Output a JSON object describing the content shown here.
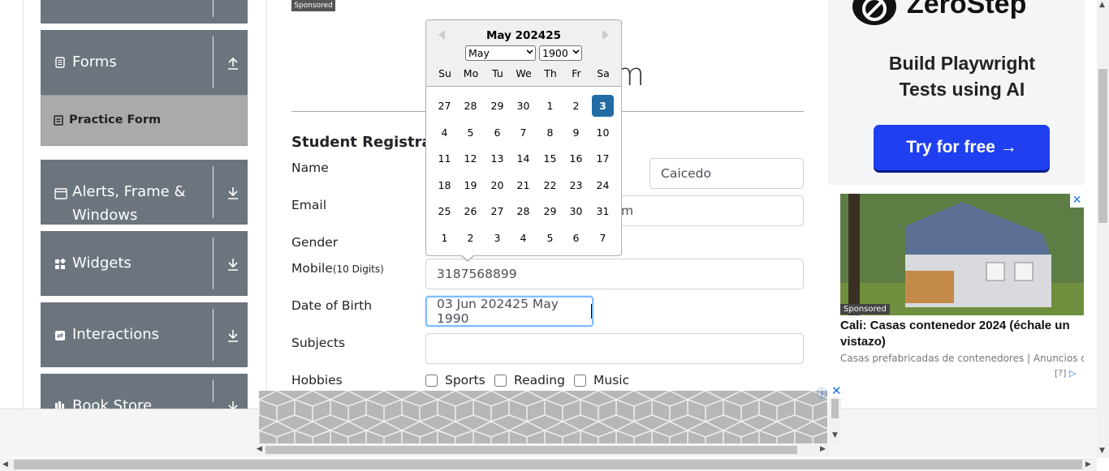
{
  "sidebar": {
    "groups": [
      {
        "label": "Forms",
        "icon": "list-icon",
        "arrow": "up"
      },
      {
        "label": "Alerts, Frame &",
        "label2": "Windows",
        "icon": "window-icon",
        "arrow": "down"
      },
      {
        "label": "Widgets",
        "icon": "widgets-icon",
        "arrow": "down"
      },
      {
        "label": "Interactions",
        "icon": "interactions-icon",
        "arrow": "down"
      },
      {
        "label": "Book Store",
        "icon": "bookstore-icon",
        "arrow": "down"
      }
    ],
    "active_item": "Practice Form"
  },
  "main": {
    "sponsored": "Sponsored",
    "title_fragment": "m",
    "form_heading": "Student Registratio",
    "labels": {
      "name": "Name",
      "email": "Email",
      "gender": "Gender",
      "mobile": "Mobile",
      "mobile_hint": "(10 Digits)",
      "dob": "Date of Birth",
      "subjects": "Subjects",
      "hobbies": "Hobbies"
    },
    "values": {
      "last_name": "Caicedo",
      "email_tail": "m",
      "mobile": "3187568899",
      "dob": "03 Jun 202425 May 1990",
      "subjects": ""
    },
    "hobbies": [
      "Sports",
      "Reading",
      "Music"
    ]
  },
  "datepicker": {
    "month_title": "May 202425",
    "month_select": "May",
    "year_select": "1900",
    "weekdays": [
      "Su",
      "Mo",
      "Tu",
      "We",
      "Th",
      "Fr",
      "Sa"
    ],
    "weeks": [
      [
        "27",
        "28",
        "29",
        "30",
        "1",
        "2",
        "3"
      ],
      [
        "4",
        "5",
        "6",
        "7",
        "8",
        "9",
        "10"
      ],
      [
        "11",
        "12",
        "13",
        "14",
        "15",
        "16",
        "17"
      ],
      [
        "18",
        "19",
        "20",
        "21",
        "22",
        "23",
        "24"
      ],
      [
        "25",
        "26",
        "27",
        "28",
        "29",
        "30",
        "31"
      ],
      [
        "1",
        "2",
        "3",
        "4",
        "5",
        "6",
        "7"
      ]
    ],
    "selected": "3",
    "accent": "#216ba5"
  },
  "ads": {
    "zerostep_name": "ZeroStep",
    "zerostep_tagline_1": "Build Playwright",
    "zerostep_tagline_2": "Tests using AI",
    "zerostep_button": "Try for free →",
    "ad2_sponsored": "Sponsored",
    "ad2_title": "Cali: Casas contenedor 2024 (échale un vistazo)",
    "ad2_sub": "Casas prefabricadas de contenedores | Anuncios de b...",
    "ad2_help": "[?]"
  }
}
